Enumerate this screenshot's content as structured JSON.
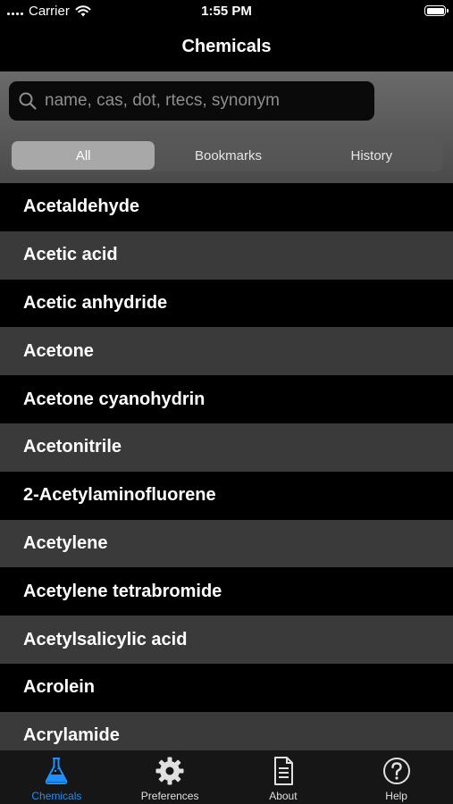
{
  "status_bar": {
    "carrier": "Carrier",
    "time": "1:55 PM"
  },
  "nav": {
    "title": "Chemicals"
  },
  "search": {
    "placeholder": "name, cas, dot, rtecs, synonym",
    "value": ""
  },
  "segments": [
    {
      "label": "All",
      "selected": true
    },
    {
      "label": "Bookmarks",
      "selected": false
    },
    {
      "label": "History",
      "selected": false
    }
  ],
  "chemicals": [
    "Acetaldehyde",
    "Acetic acid",
    "Acetic anhydride",
    "Acetone",
    "Acetone cyanohydrin",
    "Acetonitrile",
    "2-Acetylaminofluorene",
    "Acetylene",
    "Acetylene tetrabromide",
    "Acetylsalicylic acid",
    "Acrolein",
    "Acrylamide"
  ],
  "tabs": [
    {
      "label": "Chemicals",
      "icon": "flask-icon",
      "active": true
    },
    {
      "label": "Preferences",
      "icon": "gear-icon",
      "active": false
    },
    {
      "label": "About",
      "icon": "document-icon",
      "active": false
    },
    {
      "label": "Help",
      "icon": "question-icon",
      "active": false
    }
  ],
  "colors": {
    "accent": "#1e90ff",
    "background": "#000000",
    "row_alt": "#3a3a3a"
  }
}
